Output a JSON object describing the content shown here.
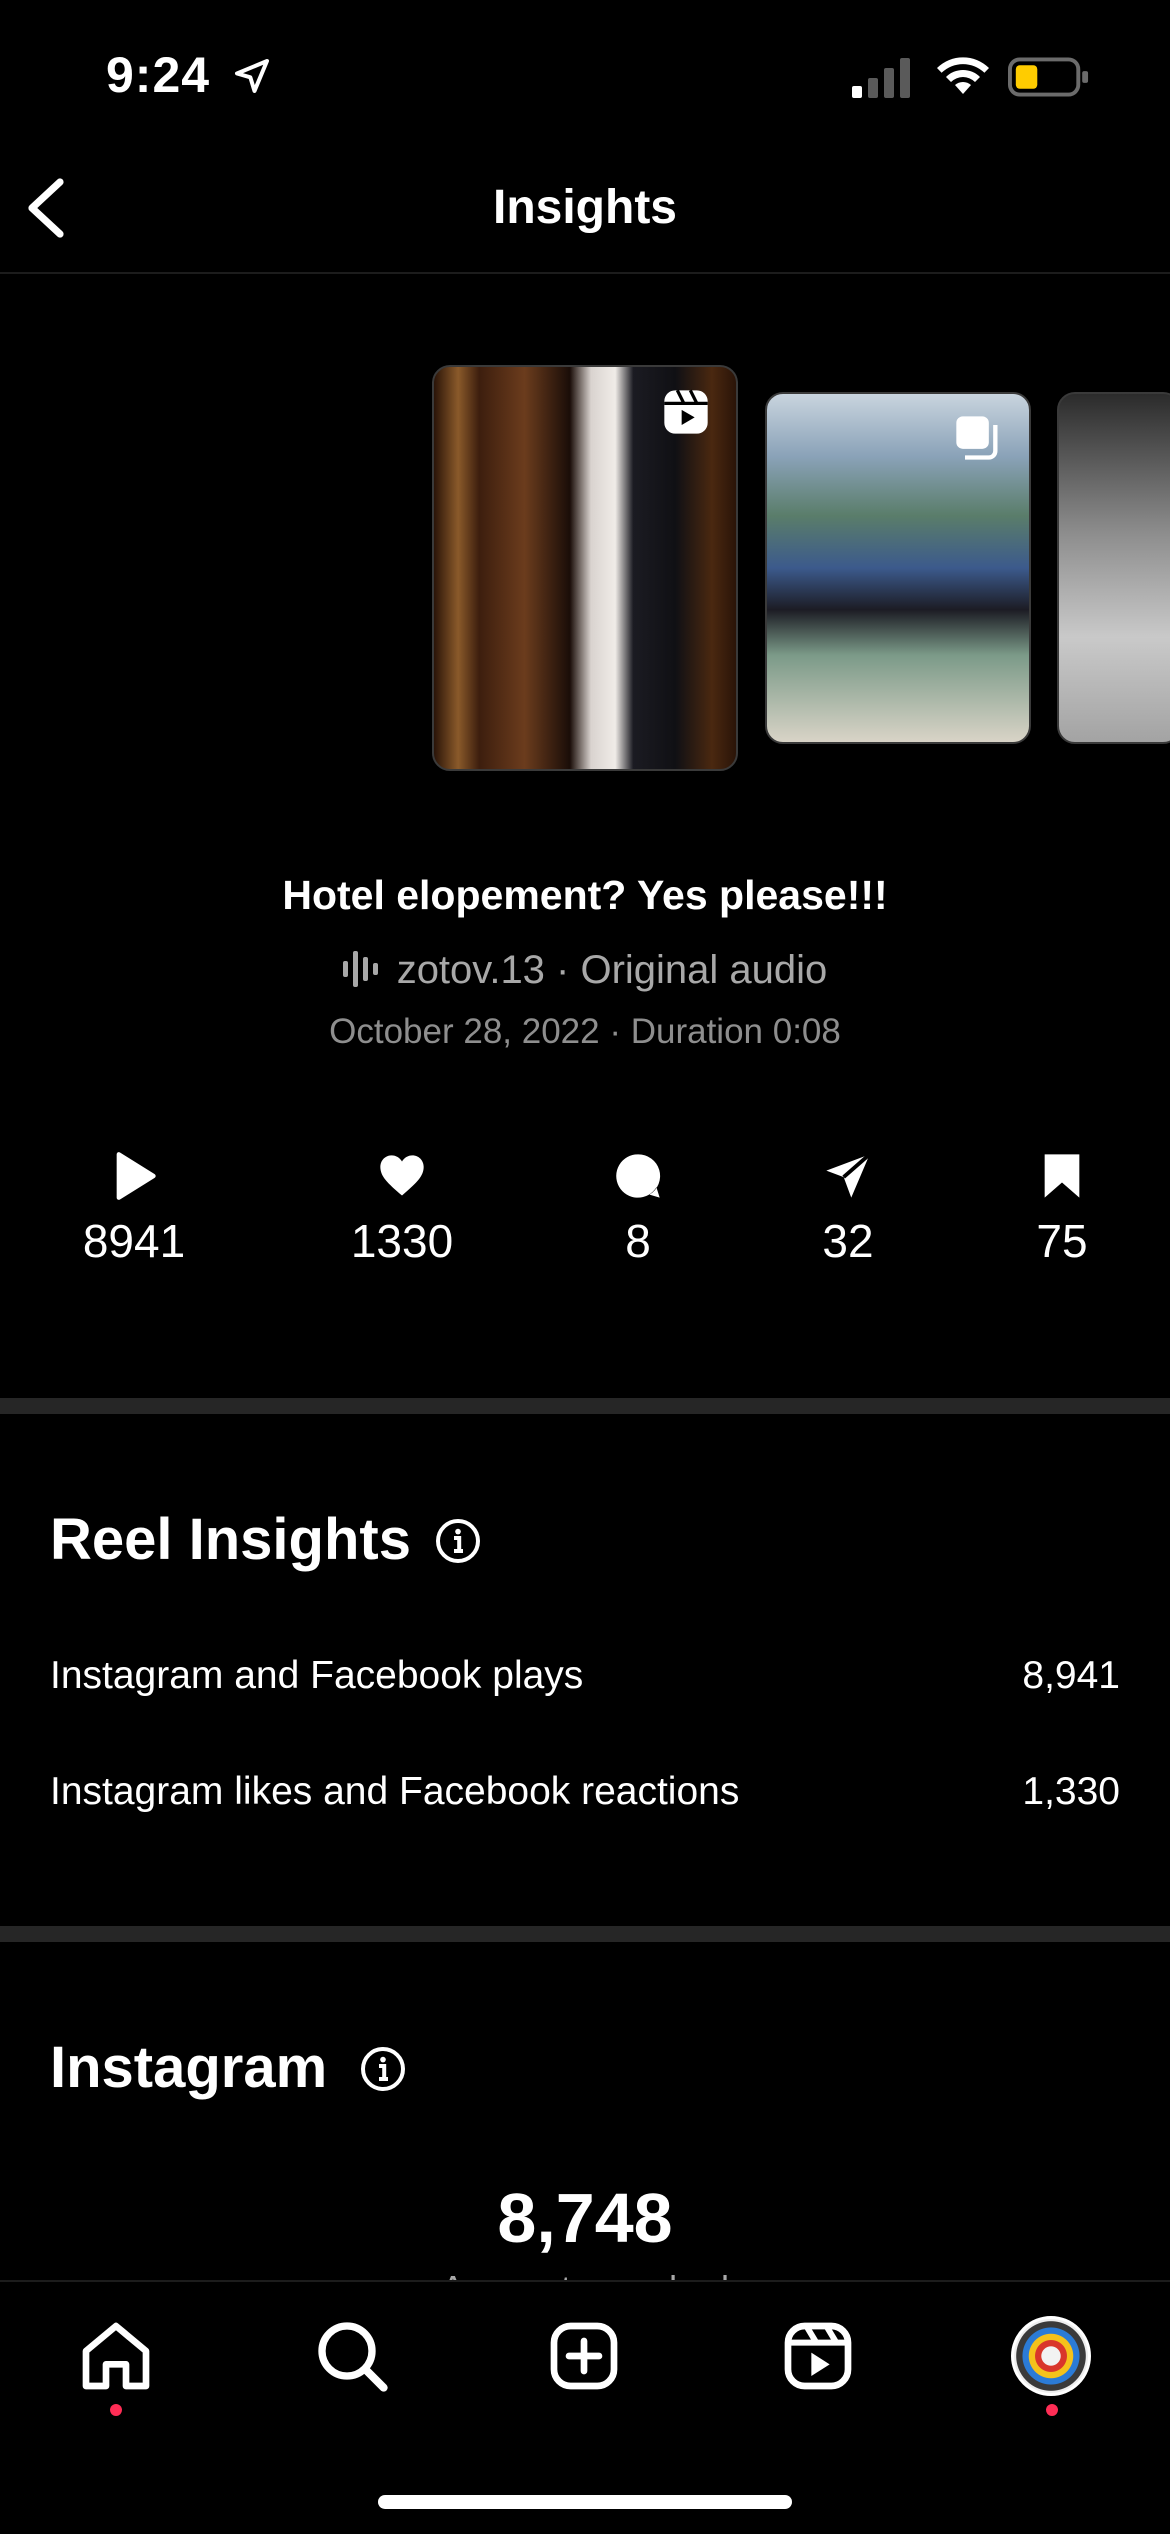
{
  "status_bar": {
    "time": "9:24"
  },
  "header": {
    "title": "Insights"
  },
  "post": {
    "title": "Hotel elopement? Yes please!!!",
    "audio": "zotov.13 · Original audio",
    "meta": "October 28, 2022 · Duration 0:08"
  },
  "stats": {
    "plays": "8941",
    "likes": "1330",
    "comments": "8",
    "shares": "32",
    "saves": "75"
  },
  "reel_insights": {
    "title": "Reel Insights",
    "rows": [
      {
        "label": "Instagram and Facebook plays",
        "value": "8,941"
      },
      {
        "label": "Instagram likes and Facebook reactions",
        "value": "1,330"
      }
    ]
  },
  "instagram": {
    "title": "Instagram",
    "big_number": "8,748",
    "big_label": "Accounts reached"
  },
  "colors": {
    "background": "#000000",
    "divider": "#262626",
    "notification_dot": "#ff2d55",
    "battery_low": "#ffcc00"
  }
}
